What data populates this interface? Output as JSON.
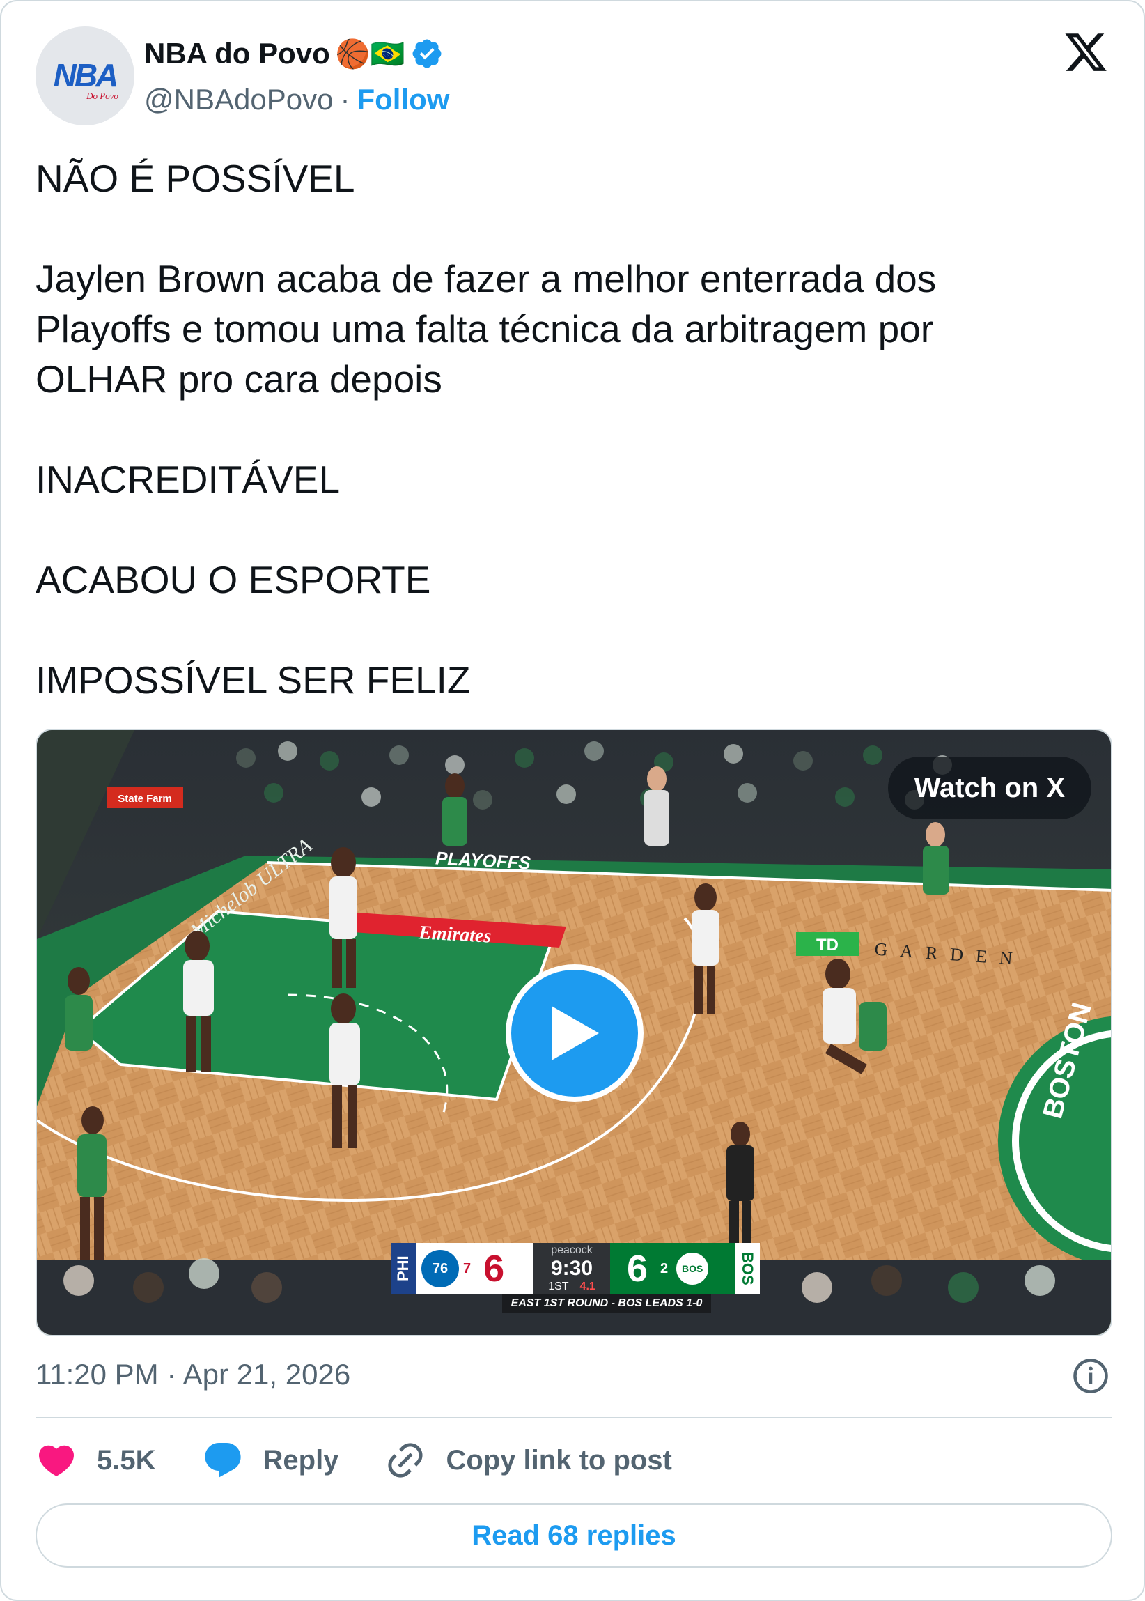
{
  "author": {
    "name": "NBA do Povo",
    "emoji": "🏀🇧🇷",
    "handle": "@NBAdoPovo",
    "separator": "·",
    "follow_label": "Follow",
    "avatar_text": "NBA",
    "avatar_subtext": "Do Povo"
  },
  "post": {
    "paragraphs": [
      "NÃO É POSSÍVEL",
      "Jaylen Brown acaba de fazer a melhor enterrada dos\nPlayoffs e tomou uma falta técnica da arbitragem por\nOLHAR pro cara depois",
      "INACREDITÁVEL",
      "ACABOU O ESPORTE",
      "IMPOSSÍVEL SER FELIZ"
    ]
  },
  "media": {
    "watch_label": "Watch on X",
    "scoreboard": {
      "away_abbr": "PHI",
      "away_logo_text": "76",
      "away_seed": "7",
      "away_score": "6",
      "network": "peacock",
      "clock": "9:30",
      "period": "1ST",
      "shot_clock": "4.1",
      "home_score": "6",
      "home_seed": "2",
      "home_logo_text": "BOS",
      "home_abbr": "BOS",
      "series_status": "EAST 1ST ROUND - BOS LEADS 1-0"
    },
    "court_signage": {
      "emirates": "Emirates",
      "playoffs": "PLAYOFFS",
      "garden": "GARDEN",
      "boston": "BOSTON",
      "statefarm": "State Farm",
      "michelob": "Michelob ULTRA"
    }
  },
  "meta": {
    "timestamp": "11:20 PM · Apr 21, 2026"
  },
  "actions": {
    "likes": "5.5K",
    "reply_label": "Reply",
    "copy_label": "Copy link to post"
  },
  "read_replies_label": "Read 68 replies",
  "colors": {
    "accent": "#1d9bf0",
    "like": "#f91880",
    "text": "#0f1419",
    "muted": "#536471",
    "border": "#cfd9de"
  }
}
